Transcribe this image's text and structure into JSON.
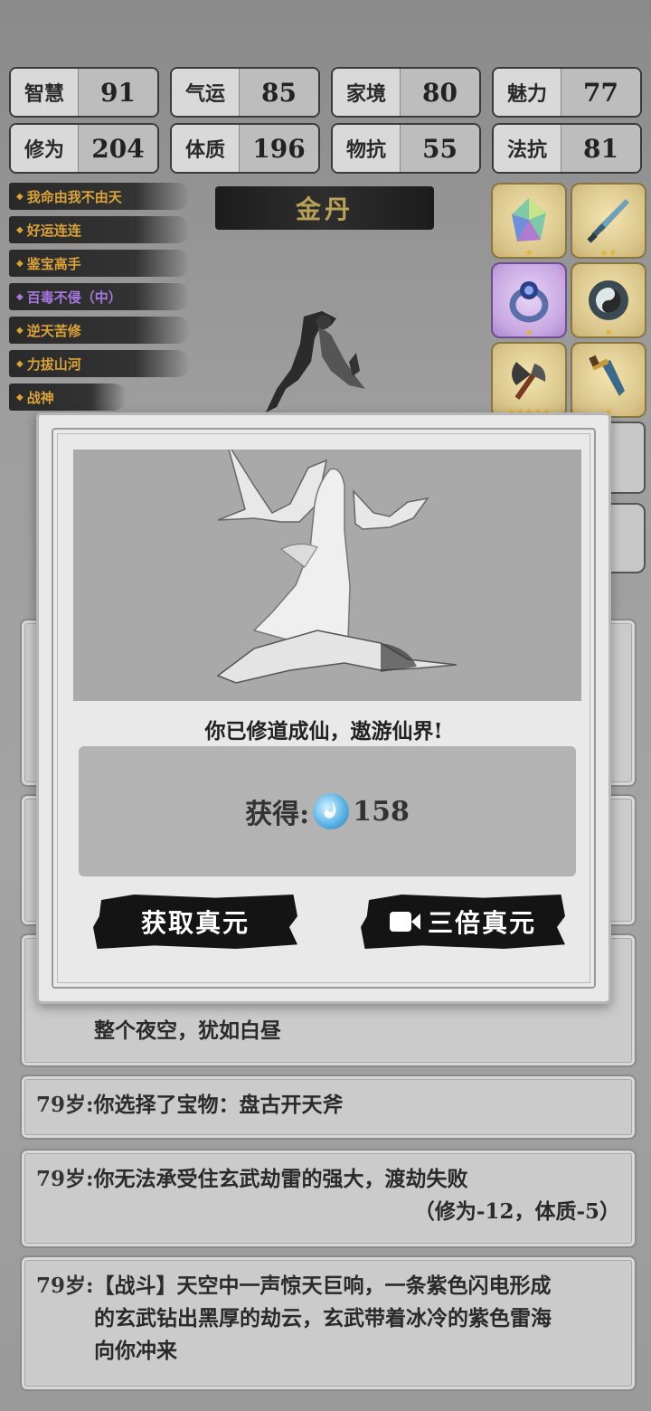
{
  "stats": [
    {
      "label": "智慧",
      "value": "91"
    },
    {
      "label": "气运",
      "value": "85"
    },
    {
      "label": "家境",
      "value": "80"
    },
    {
      "label": "魅力",
      "value": "77"
    },
    {
      "label": "修为",
      "value": "204"
    },
    {
      "label": "体质",
      "value": "196"
    },
    {
      "label": "物抗",
      "value": "55"
    },
    {
      "label": "法抗",
      "value": "81"
    }
  ],
  "traits": [
    {
      "label": "我命由我不由天",
      "color": "#d9a23a"
    },
    {
      "label": "好运连连",
      "color": "#d9a23a"
    },
    {
      "label": "鉴宝高手",
      "color": "#d9a23a"
    },
    {
      "label": "百毒不侵（中）",
      "color": "#a678e0"
    },
    {
      "label": "逆天苦修",
      "color": "#d9a23a"
    },
    {
      "label": "力拔山河",
      "color": "#d9a23a"
    },
    {
      "label": "战神",
      "color": "#d9a23a"
    }
  ],
  "realm": "金丹",
  "treasures": [
    {
      "icon": "crystal-icon",
      "stars": "★"
    },
    {
      "icon": "sword-icon",
      "stars": "★★"
    },
    {
      "icon": "ring-icon",
      "stars": "★"
    },
    {
      "icon": "mirror-icon",
      "stars": "★"
    },
    {
      "icon": "axe-icon",
      "stars": "★★★★★"
    },
    {
      "icon": "dagger-icon",
      "stars": "★"
    }
  ],
  "log": [
    {
      "text": "整个夜空，犹如白昼"
    },
    {
      "age": "79岁:",
      "text": "你选择了宝物：盘古开天斧"
    },
    {
      "age": "79岁:",
      "text": "你无法承受住玄武劫雷的强大，渡劫失败",
      "note": "（修为-12，体质-5）"
    },
    {
      "age": "79岁:",
      "text": "【战斗】天空中一声惊天巨响，一条紫色闪电形成",
      "line2": "的玄武钻出黑厚的劫云，玄武带着冰冷的紫色雷海",
      "line3": "向你冲来"
    }
  ],
  "modal": {
    "message": "你已修道成仙，遨游仙界!",
    "reward_label": "获得:",
    "reward_value": "158",
    "reward_icon": "spirit-essence-icon",
    "btn_get": "获取真元",
    "btn_triple": "三倍真元",
    "btn_triple_icon": "video-camera-icon"
  }
}
